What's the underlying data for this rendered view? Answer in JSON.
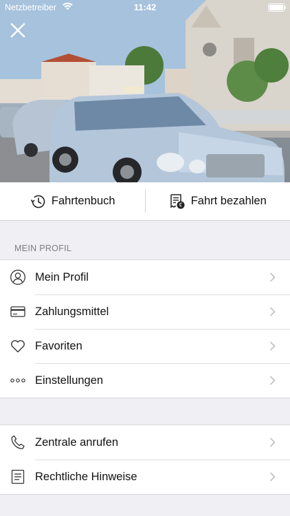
{
  "status_bar": {
    "carrier": "Netzbetreiber",
    "time": "11:42"
  },
  "hero": {
    "image_description_icon": "taxi-photo",
    "close_icon": "close-icon"
  },
  "actions": [
    {
      "label": "Fahrtenbuch",
      "icon": "history-icon"
    },
    {
      "label": "Fahrt bezahlen",
      "icon": "pay-ride-icon"
    }
  ],
  "profile_section": {
    "header": "MEIN PROFIL",
    "items": [
      {
        "label": "Mein Profil",
        "icon": "user-icon"
      },
      {
        "label": "Zahlungsmittel",
        "icon": "credit-card-icon"
      },
      {
        "label": "Favoriten",
        "icon": "heart-icon"
      },
      {
        "label": "Einstellungen",
        "icon": "more-dots-icon"
      }
    ]
  },
  "support_section": {
    "items": [
      {
        "label": "Zentrale anrufen",
        "icon": "phone-icon"
      },
      {
        "label": "Rechtliche Hinweise",
        "icon": "document-icon"
      }
    ]
  },
  "colors": {
    "background": "#efeff4",
    "row_background": "#ffffff",
    "text": "#111111",
    "secondary_text": "#7c7c80",
    "chevron": "#c4c4c8"
  }
}
